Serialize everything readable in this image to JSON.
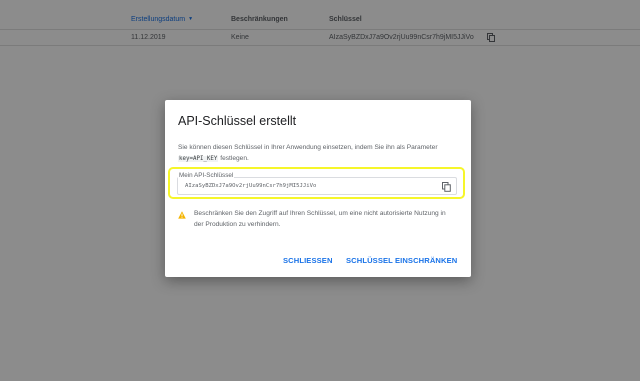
{
  "table": {
    "headers": {
      "created": "Erstellungsdatum",
      "restrictions": "Beschränkungen",
      "key": "Schlüssel"
    },
    "sort_icon": "arrow-down-icon",
    "row": {
      "date": "11.12.2019",
      "restrictions": "Keine",
      "key": "AIzaSyBZDxJ7a9Ov2rjUu99nCsr7h9jMI5JJiVo"
    }
  },
  "dialog": {
    "title": "API-Schlüssel erstellt",
    "desc_part1": "Sie können diesen Schlüssel in Ihrer Anwendung einsetzen, indem Sie ihn als Parameter",
    "desc_code": "key=API_KEY",
    "desc_part2": "festlegen.",
    "field_label": "Mein API-Schlüssel",
    "field_value": "AIzaSyBZDxJ7a9Ov2rjUu99nCsr7h9jMI5JJiVo",
    "warning": "Beschränken Sie den Zugriff auf Ihren Schlüssel, um eine nicht autorisierte Nutzung in der Produktion zu verhindern.",
    "close_label": "SCHLIESSEN",
    "restrict_label": "SCHLÜSSEL EINSCHRÄNKEN"
  },
  "colors": {
    "accent": "#1a73e8",
    "highlight": "#f6f62a",
    "warning": "#f4b400"
  }
}
